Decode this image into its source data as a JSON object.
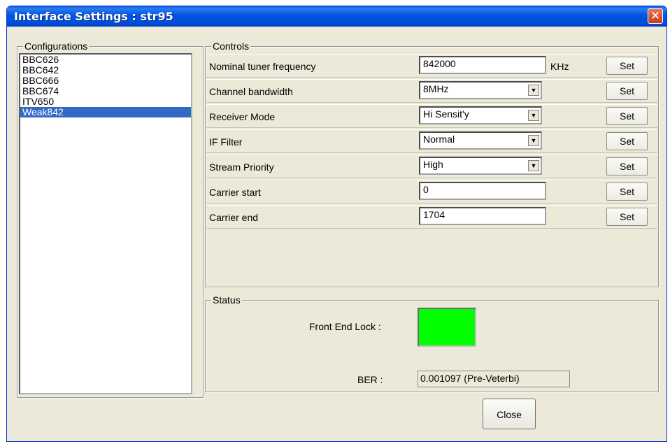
{
  "window": {
    "title": "Interface Settings : str95",
    "close_glyph": "✕"
  },
  "configurations": {
    "label": "Configurations",
    "items": [
      "BBC626",
      "BBC642",
      "BBC666",
      "BBC674",
      "ITV650",
      "Weak842"
    ],
    "selected": "Weak842"
  },
  "controls": {
    "label": "Controls",
    "rows": [
      {
        "label": "Nominal tuner frequency",
        "type": "text",
        "value": "842000",
        "unit": "KHz",
        "button": "Set"
      },
      {
        "label": "Channel bandwidth",
        "type": "combo",
        "value": "8MHz",
        "button": "Set"
      },
      {
        "label": "Receiver Mode",
        "type": "combo",
        "value": "Hi Sensit'y",
        "button": "Set"
      },
      {
        "label": "IF Filter",
        "type": "combo",
        "value": "Normal",
        "button": "Set"
      },
      {
        "label": "Stream Priority",
        "type": "combo",
        "value": "High",
        "button": "Set"
      },
      {
        "label": "Carrier start",
        "type": "text",
        "value": "0",
        "button": "Set"
      },
      {
        "label": "Carrier end",
        "type": "text",
        "value": "1704",
        "button": "Set"
      }
    ]
  },
  "status": {
    "label": "Status",
    "front_end_lock_label": "Front End Lock :",
    "front_end_lock_color": "#00ff00",
    "ber_label": "BER :",
    "ber_value": "0.001097 (Pre-Veterbi)"
  },
  "footer": {
    "close_label": "Close"
  },
  "icons": {
    "combo_arrow": "dropdown-arrow-icon",
    "window_close": "close-icon"
  }
}
